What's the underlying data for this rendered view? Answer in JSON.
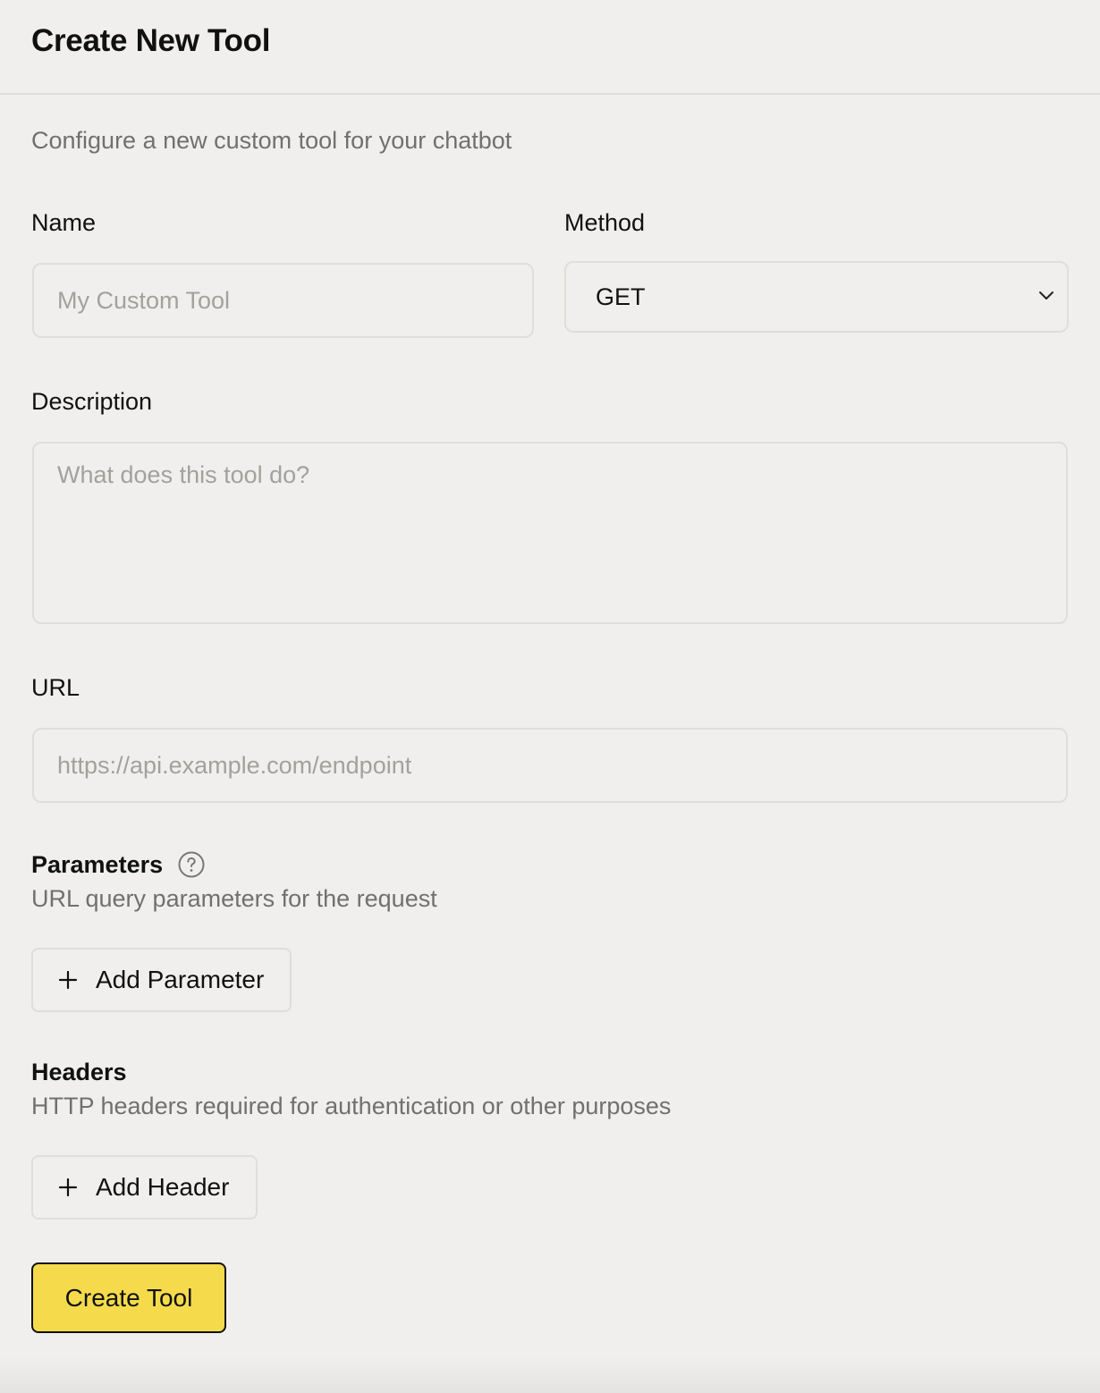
{
  "header": {
    "title": "Create New Tool"
  },
  "form": {
    "subtitle": "Configure a new custom tool for your chatbot",
    "name": {
      "label": "Name",
      "placeholder": "My Custom Tool",
      "value": ""
    },
    "method": {
      "label": "Method",
      "value": "GET"
    },
    "description": {
      "label": "Description",
      "placeholder": "What does this tool do?",
      "value": ""
    },
    "url": {
      "label": "URL",
      "placeholder": "https://api.example.com/endpoint",
      "value": ""
    },
    "parameters": {
      "title": "Parameters",
      "description": "URL query parameters for the request",
      "add_label": "Add Parameter"
    },
    "headers": {
      "title": "Headers",
      "description": "HTTP headers required for authentication or other purposes",
      "add_label": "Add Header"
    },
    "submit_label": "Create Tool"
  },
  "icons": {
    "method_dropdown": "chevron-down-icon",
    "parameters_help": "help-circle-icon",
    "add": "plus-icon"
  },
  "colors": {
    "background": "#f0efed",
    "primary_button": "#f5db4b",
    "muted_text": "#707070",
    "border": "#e0deda"
  }
}
